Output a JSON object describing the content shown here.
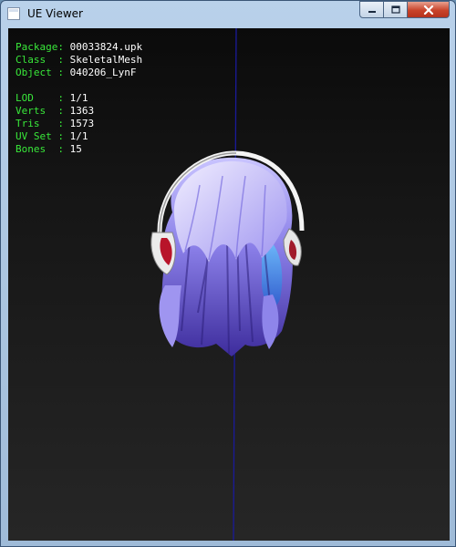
{
  "window": {
    "title": "UE Viewer",
    "icon": "app-icon",
    "buttons": [
      "minimize-icon",
      "maximize-icon",
      "close-icon"
    ]
  },
  "info": {
    "package": {
      "label": "Package: ",
      "value": "00033824.upk"
    },
    "class": {
      "label": "Class  : ",
      "value": "SkeletalMesh"
    },
    "object": {
      "label": "Object : ",
      "value": "040206_LynF"
    },
    "lod": {
      "label": "LOD    : ",
      "value": "1/1"
    },
    "verts": {
      "label": "Verts  : ",
      "value": "1363"
    },
    "tris": {
      "label": "Tris   : ",
      "value": "1573"
    },
    "uvset": {
      "label": "UV Set : ",
      "value": "1/1"
    },
    "bones": {
      "label": "Bones  : ",
      "value": "15"
    }
  },
  "colors": {
    "info_label": "#39e83a",
    "info_value": "#ffffff",
    "axis": "#1a1a9a",
    "hair": "#7a6fe0"
  }
}
